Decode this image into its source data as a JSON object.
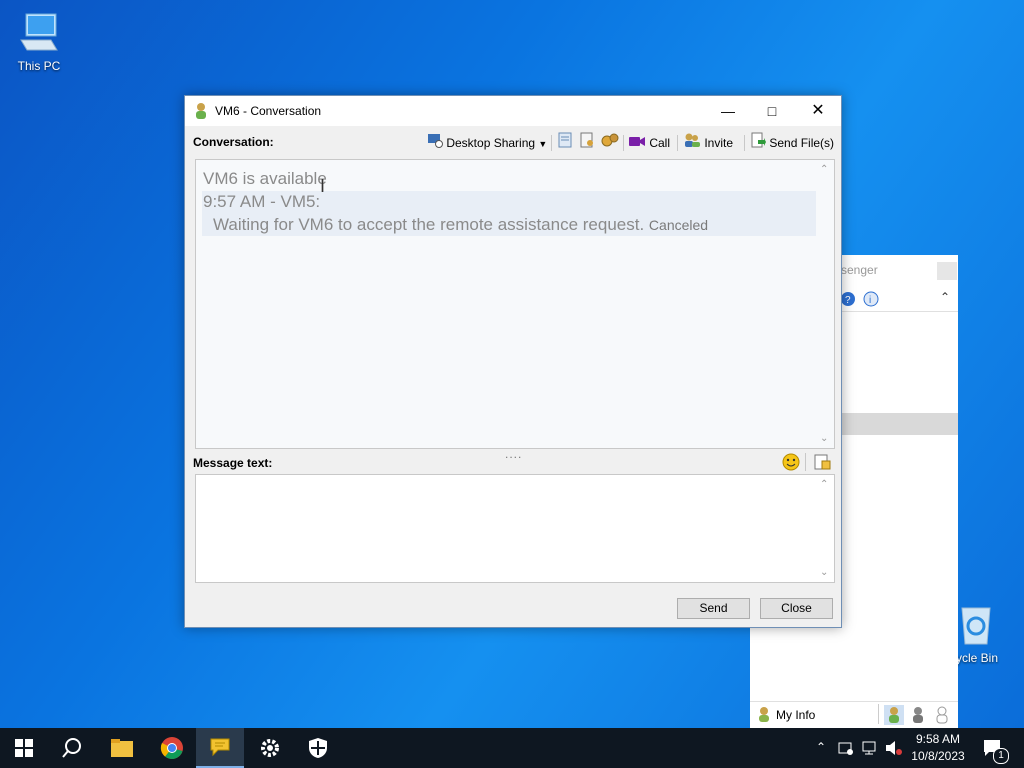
{
  "desktop": {
    "this_pc_label": "This PC",
    "recycle_bin_label": "cycle Bin"
  },
  "bg_window": {
    "title_partial": "ssenger",
    "my_info_label": "My Info"
  },
  "window": {
    "title": "VM6 - Conversation",
    "conversation_label": "Conversation:",
    "message_label": "Message text:",
    "toolbar": {
      "desktop_sharing": "Desktop Sharing",
      "call": "Call",
      "invite": "Invite",
      "send_files": "Send File(s)"
    },
    "conversation": {
      "status_line": "VM6 is available",
      "header_line": "9:57 AM - VM5:",
      "message_line": "Waiting for VM6 to accept the remote assistance request.",
      "message_status": "Canceled"
    },
    "buttons": {
      "send": "Send",
      "close": "Close"
    }
  },
  "taskbar": {
    "time": "9:58 AM",
    "date": "10/8/2023",
    "notification_count": "1"
  },
  "colors": {
    "accent": "#0a74e0",
    "taskbar": "#0e1721"
  }
}
